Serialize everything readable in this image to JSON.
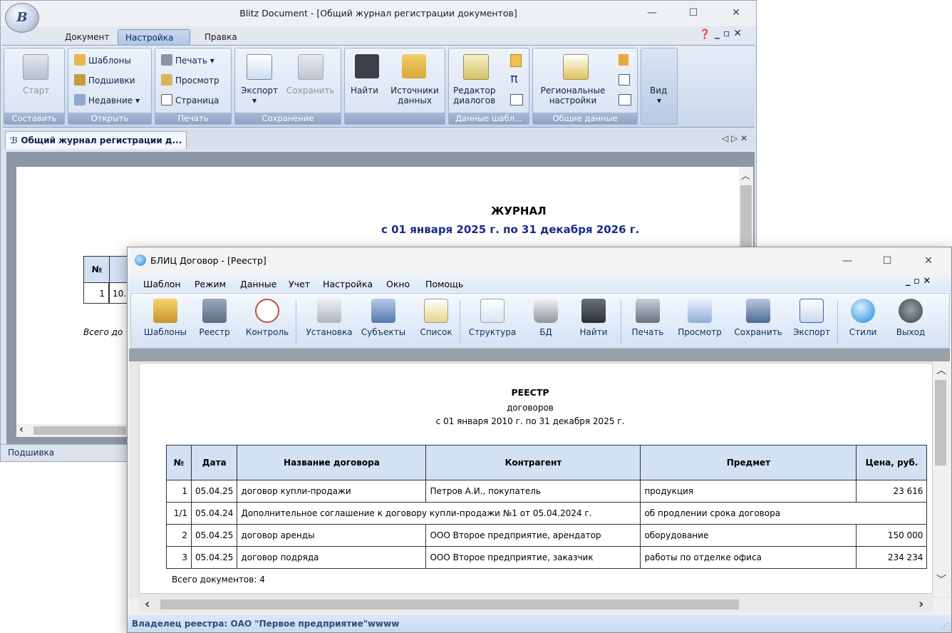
{
  "blitz": {
    "title": "Blitz Document - [Общий журнал регистрации документов]",
    "logo": "B",
    "tabs": [
      "Документ",
      "Настройка",
      "Правка"
    ],
    "active_tab": "Настройка",
    "groups": {
      "sostavit": {
        "caption": "Составить",
        "start": "Старт"
      },
      "otkryt": {
        "caption": "Открыть",
        "templates": "Шаблоны",
        "bindings": "Подшивки",
        "recent": "Недавние"
      },
      "pechat": {
        "caption": "Печать",
        "print": "Печать",
        "preview": "Просмотр",
        "page": "Страница"
      },
      "sohranenie": {
        "caption": "Сохранение",
        "export": "Экспорт",
        "save": "Сохранить"
      },
      "data": {
        "find": "Найти",
        "sources": "Источники данных"
      },
      "templates_data": {
        "caption": "Данные шабл...",
        "editor": "Редактор диалогов",
        "pi": "π"
      },
      "common": {
        "caption": "Общие данные",
        "regional": "Региональные настройки"
      },
      "view": "Вид"
    },
    "doc_tab": "Общий журнал регистрации д...",
    "doc_tab_controls": "◁ ▷ ✕",
    "journal_title": "ЖУРНАЛ",
    "journal_period": "с 01 января 2025 г. по 31 декабря 2026 г.",
    "table_num_header": "№",
    "row1_num": "1",
    "row1_partial": "10.",
    "total_partial": "Всего до",
    "status": "Подшивка"
  },
  "dogovor": {
    "title": "БЛИЦ Договор - [Реестр]",
    "menus": [
      "Шаблон",
      "Режим",
      "Данные",
      "Учет",
      "Настройка",
      "Окно",
      "Помощь"
    ],
    "toolbar": [
      "Шаблоны",
      "Реестр",
      "Контроль",
      "Установка",
      "Субъекты",
      "Список",
      "Структура",
      "БД",
      "Найти",
      "Печать",
      "Просмотр",
      "Сохранить",
      "Экспорт",
      "Стили",
      "Выход"
    ],
    "report_title": "РЕЕСТР",
    "report_subtitle": "договоров",
    "report_period": "с 01 января 2010 г. по 31 декабря 2025 г.",
    "columns": [
      "№",
      "Дата",
      "Название договора",
      "Контрагент",
      "Предмет",
      "Цена, руб."
    ],
    "rows": [
      {
        "num": "1",
        "date": "05.04.25",
        "name": "договор купли-продажи",
        "party": "Петров А.И., покупатель",
        "subject": "продукция",
        "price": "23 616"
      },
      {
        "num": "1/1",
        "date": "05.04.24",
        "name": "Дополнительное соглашение к договору купли-продажи №1 от 05.04.2024 г.",
        "party": "",
        "subject": "об продлении срока договора",
        "price": ""
      },
      {
        "num": "2",
        "date": "05.04.25",
        "name": "договор аренды",
        "party": "ООО Второе предприятие, арендатор",
        "subject": "оборудование",
        "price": "150 000"
      },
      {
        "num": "3",
        "date": "05.04.25",
        "name": "договор подряда",
        "party": "ООО Второе предприятие, заказчик",
        "subject": "работы по отделке офиса",
        "price": "234 234"
      }
    ],
    "total": "Всего документов: 4",
    "status": "Владелец реестра: ОАО \"Первое предприятие\"wwww"
  }
}
